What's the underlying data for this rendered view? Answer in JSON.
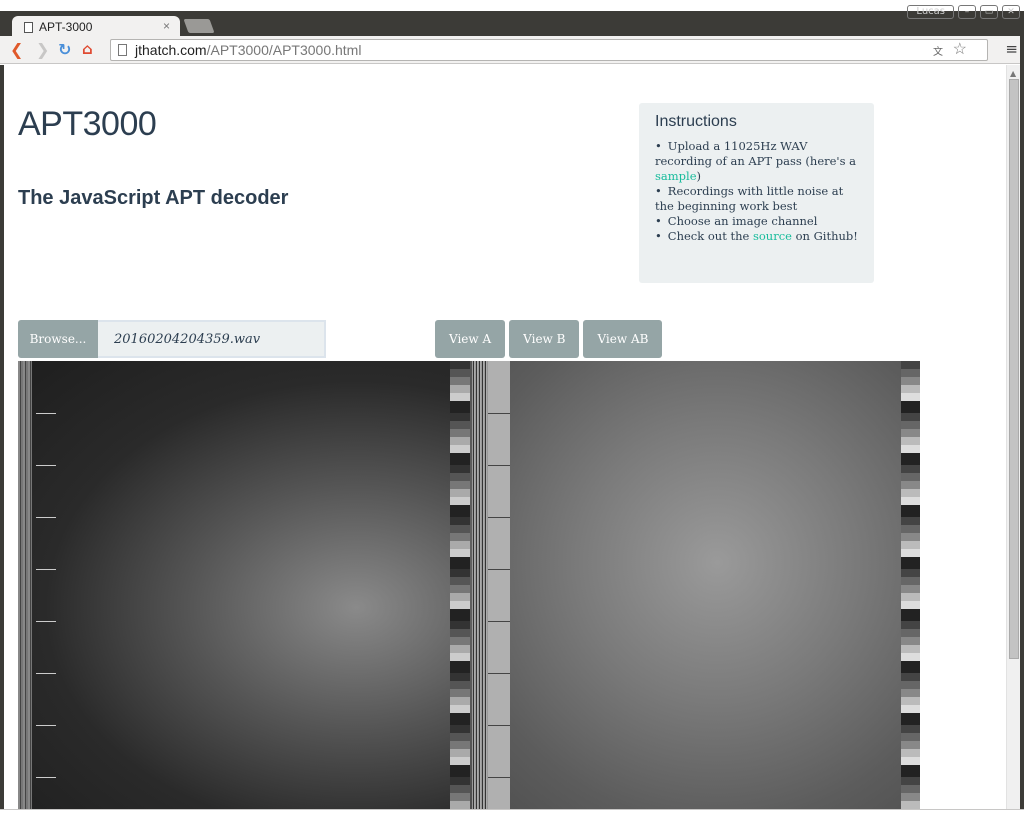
{
  "window": {
    "user_label": "Lucas",
    "controls": [
      "–",
      "▭",
      "✕"
    ]
  },
  "browser": {
    "tab_title": "APT-3000",
    "tab_close": "×",
    "url_host": "jthatch.com",
    "url_path": "/APT3000/APT3000.html",
    "back_glyph": "❮",
    "forward_glyph": "❯",
    "reload_glyph": "↻",
    "home_glyph": "⌂",
    "star_glyph": "☆",
    "menu_glyph": "≡",
    "translate_glyph": "文A"
  },
  "page": {
    "title": "APT3000",
    "subtitle": "The JavaScript APT decoder",
    "instructions": {
      "heading": "Instructions",
      "items": [
        {
          "pre": "Upload a 11025Hz WAV recording of an APT pass (here's a ",
          "link": "sample",
          "post": ")"
        },
        {
          "pre": "Recordings with little noise at the beginning work best",
          "link": "",
          "post": ""
        },
        {
          "pre": "Choose an image channel",
          "link": "",
          "post": ""
        },
        {
          "pre": "Check out the ",
          "link": "source",
          "post": " on Github!"
        }
      ]
    },
    "file_input": {
      "browse_label": "Browse...",
      "file_name": "20160204204359.wav"
    },
    "view_buttons": [
      "View A",
      "View B",
      "View AB"
    ],
    "image_alt": "Decoded APT satellite image with channels A and B"
  },
  "colors": {
    "text_primary": "#2c3e50",
    "link": "#18bc9c",
    "button_bg": "#95a5a6",
    "panel_bg": "#ecf0f1"
  }
}
